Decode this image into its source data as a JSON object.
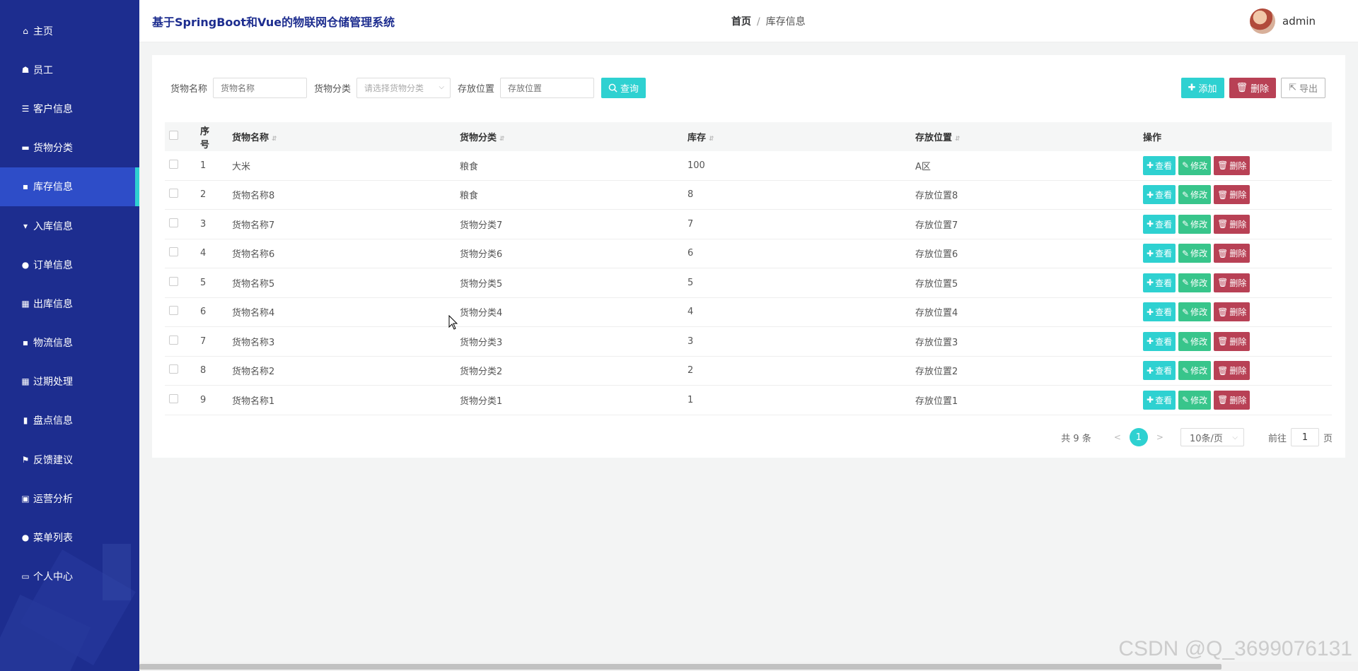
{
  "sidebar": {
    "items": [
      {
        "label": "主页",
        "icon": "home-icon",
        "glyph": "⌂"
      },
      {
        "label": "员工",
        "icon": "user-group-icon",
        "glyph": "☗"
      },
      {
        "label": "客户信息",
        "icon": "sliders-icon",
        "glyph": "☰"
      },
      {
        "label": "货物分类",
        "icon": "card-icon",
        "glyph": "▬"
      },
      {
        "label": "库存信息",
        "icon": "message-icon",
        "glyph": "▪"
      },
      {
        "label": "入库信息",
        "icon": "stamp-icon",
        "glyph": "▾"
      },
      {
        "label": "订单信息",
        "icon": "user-icon",
        "glyph": "●"
      },
      {
        "label": "出库信息",
        "icon": "grid-icon",
        "glyph": "▦"
      },
      {
        "label": "物流信息",
        "icon": "truck-icon",
        "glyph": "▪"
      },
      {
        "label": "过期处理",
        "icon": "grid-icon",
        "glyph": "▦"
      },
      {
        "label": "盘点信息",
        "icon": "bar-chart-icon",
        "glyph": "▮"
      },
      {
        "label": "反馈建议",
        "icon": "flag-icon",
        "glyph": "⚑"
      },
      {
        "label": "运营分析",
        "icon": "clipboard-icon",
        "glyph": "▣"
      },
      {
        "label": "菜单列表",
        "icon": "bulb-icon",
        "glyph": "●"
      },
      {
        "label": "个人中心",
        "icon": "profile-card-icon",
        "glyph": "▭"
      }
    ],
    "active_index": 4
  },
  "header": {
    "title": "基于SpringBoot和Vue的物联网仓储管理系统",
    "breadcrumb_home": "首页",
    "breadcrumb_sep": "/",
    "breadcrumb_current": "库存信息",
    "username": "admin"
  },
  "search": {
    "name_label": "货物名称",
    "name_placeholder": "货物名称",
    "category_label": "货物分类",
    "category_placeholder": "请选择货物分类",
    "location_label": "存放位置",
    "location_placeholder": "存放位置",
    "query_label": "查询"
  },
  "actions": {
    "add_label": "添加",
    "delete_label": "删除",
    "export_label": "导出"
  },
  "table": {
    "columns": [
      "序号",
      "货物名称",
      "货物分类",
      "库存",
      "存放位置",
      "操作"
    ],
    "rows": [
      {
        "no": "1",
        "name": "大米",
        "category": "粮食",
        "stock": "100",
        "location": "A区"
      },
      {
        "no": "2",
        "name": "货物名称8",
        "category": "粮食",
        "stock": "8",
        "location": "存放位置8"
      },
      {
        "no": "3",
        "name": "货物名称7",
        "category": "货物分类7",
        "stock": "7",
        "location": "存放位置7"
      },
      {
        "no": "4",
        "name": "货物名称6",
        "category": "货物分类6",
        "stock": "6",
        "location": "存放位置6"
      },
      {
        "no": "5",
        "name": "货物名称5",
        "category": "货物分类5",
        "stock": "5",
        "location": "存放位置5"
      },
      {
        "no": "6",
        "name": "货物名称4",
        "category": "货物分类4",
        "stock": "4",
        "location": "存放位置4"
      },
      {
        "no": "7",
        "name": "货物名称3",
        "category": "货物分类3",
        "stock": "3",
        "location": "存放位置3"
      },
      {
        "no": "8",
        "name": "货物名称2",
        "category": "货物分类2",
        "stock": "2",
        "location": "存放位置2"
      },
      {
        "no": "9",
        "name": "货物名称1",
        "category": "货物分类1",
        "stock": "1",
        "location": "存放位置1"
      }
    ],
    "op_view": "查看",
    "op_edit": "修改",
    "op_delete": "删除"
  },
  "pagination": {
    "total_text": "共 9 条",
    "current_page": "1",
    "page_size": "10条/页",
    "goto_prefix": "前往",
    "goto_value": "1",
    "goto_suffix": "页"
  },
  "watermark": "CSDN @Q_3699076131",
  "colors": {
    "sidebar_bg": "#1d2d8f",
    "active_item": "#2e4dc8",
    "accent_teal": "#2ed1d1",
    "edit_green": "#38c58b",
    "delete_red": "#b84155"
  }
}
